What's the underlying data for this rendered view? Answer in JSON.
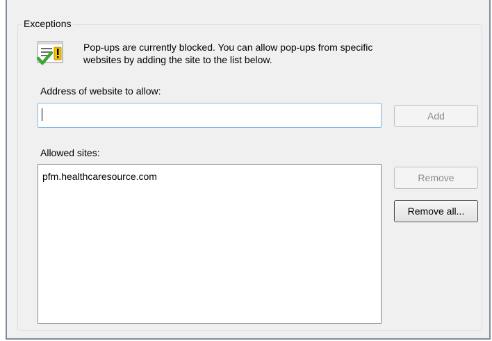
{
  "exceptions": {
    "group_title": "Exceptions",
    "info_line1": "Pop-ups are currently blocked.  You can allow pop-ups from specific",
    "info_line2": "websites by adding the site to the list below.",
    "address_label": "Address of website to allow:",
    "address_value": "",
    "add_button": "Add",
    "allowed_label": "Allowed sites:",
    "allowed_sites": [
      "pfm.healthcaresource.com"
    ],
    "remove_button": "Remove",
    "remove_all_button": "Remove all..."
  },
  "icons": {
    "info": "exception-check-warning-icon"
  },
  "colors": {
    "dialog_bg": "#f0f0f0",
    "input_focus_border": "#7eb4ea",
    "warning_yellow": "#f5c300",
    "check_green": "#3aa835"
  }
}
